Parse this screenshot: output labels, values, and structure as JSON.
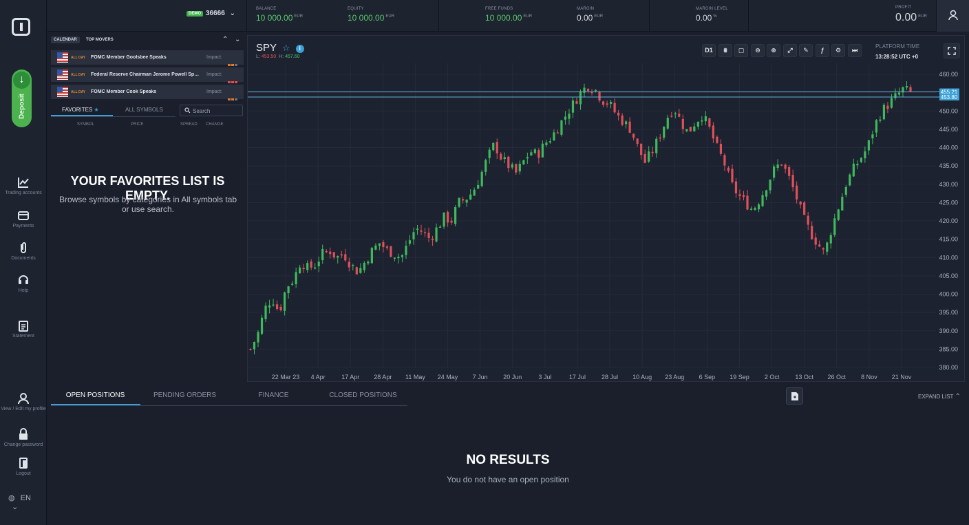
{
  "account": {
    "badge": "DEMO",
    "number": "36666"
  },
  "stats": [
    {
      "key": "BALANCE",
      "value": "10 000.00",
      "unit": "EUR"
    },
    {
      "key": "EQUITY",
      "value": "10 000.00",
      "unit": "EUR"
    },
    {
      "key": "FREE FUNDS",
      "value": "10 000.00",
      "unit": "EUR"
    },
    {
      "key": "MARGIN",
      "value": "0.00",
      "unit": "EUR"
    },
    {
      "key": "MARGIN LEVEL",
      "value": "0.00",
      "unit": "%"
    },
    {
      "key": "PROFIT",
      "value": "0.00",
      "unit": "EUR"
    }
  ],
  "nav": {
    "deposit": "Deposit",
    "trading_accounts": "Trading accounts",
    "payments": "Payments",
    "documents": "Documents",
    "help": "Help",
    "statement": "Statement",
    "profile": "View / Edit my profile",
    "change_password": "Change password",
    "logout": "Logout",
    "language": "EN"
  },
  "calendar": {
    "tabs": [
      "CALENDAR",
      "TOP MOVERS"
    ],
    "events": [
      {
        "time": "ALL DAY",
        "title": "FOMC Member Goolsbee Speaks",
        "impact_label": "Impact:",
        "impact": 2,
        "impact_color": "#e07a2e"
      },
      {
        "time": "ALL DAY",
        "title": "Federal Reserve Chairman Jerome Powell Speaks",
        "impact_label": "Impact:",
        "impact": 3,
        "impact_color": "#e24c4c"
      },
      {
        "time": "ALL DAY",
        "title": "FOMC Member Cook Speaks",
        "impact_label": "Impact:",
        "impact": 2,
        "impact_color": "#e07a2e"
      }
    ]
  },
  "favorites": {
    "tabs": [
      "FAVORITES",
      "ALL SYMBOLS"
    ],
    "search_placeholder": "Search",
    "columns": [
      "SYMBOL",
      "PRICE",
      "SPREAD",
      "CHANGE"
    ],
    "empty_title": "YOUR FAVORITES LIST IS EMPTY.",
    "empty_text": "Browse symbols by categories in All symbols tab or use search."
  },
  "chart": {
    "symbol": "SPY",
    "low_label": "L:",
    "low": "453.50",
    "high_label": "H:",
    "high": "457.60",
    "timeframe": "D1",
    "platform_time_label": "PLATFORM TIME",
    "platform_time": "13:28:52 UTC +0",
    "price_tag_ask": "455.21",
    "price_tag_bid": "453.80",
    "up_color": "#3fb95c",
    "down_color": "#e0505a"
  },
  "chart_data": {
    "type": "candlestick",
    "title": "SPY",
    "x_labels": [
      "22 Mar 23",
      "4 Apr",
      "17 Apr",
      "28 Apr",
      "11 May",
      "24 May",
      "7 Jun",
      "20 Jun",
      "3 Jul",
      "17 Jul",
      "28 Jul",
      "10 Aug",
      "23 Aug",
      "6 Sep",
      "19 Sep",
      "2 Oct",
      "13 Oct",
      "26 Oct",
      "8 Nov",
      "21 Nov"
    ],
    "y_ticks": [
      "460.00",
      "455.00",
      "450.00",
      "445.00",
      "440.00",
      "435.00",
      "430.00",
      "425.00",
      "420.00",
      "415.00",
      "410.00",
      "405.00",
      "400.00",
      "395.00",
      "390.00",
      "385.00",
      "380.00"
    ],
    "ylim": [
      380,
      460
    ],
    "close_path": [
      385,
      389,
      396,
      399,
      395,
      402,
      404,
      409,
      407,
      408,
      411,
      412,
      410,
      411,
      408,
      406,
      409,
      412,
      414,
      412,
      411,
      410,
      414,
      418,
      417,
      415,
      418,
      421,
      420,
      425,
      426,
      428,
      432,
      437,
      441,
      437,
      435,
      433,
      436,
      439,
      438,
      441,
      443,
      446,
      449,
      452,
      455,
      457,
      456,
      453,
      452,
      449,
      447,
      445,
      440,
      436,
      439,
      443,
      448,
      451,
      447,
      444,
      447,
      449,
      445,
      440,
      436,
      430,
      427,
      425,
      423,
      426,
      430,
      434,
      436,
      432,
      427,
      421,
      417,
      414,
      411,
      418,
      424,
      430,
      434,
      437,
      440,
      446,
      450,
      452,
      454,
      456,
      455
    ]
  },
  "bottom": {
    "tabs": [
      "OPEN POSITIONS",
      "PENDING ORDERS",
      "FINANCE",
      "CLOSED POSITIONS"
    ],
    "expand": "EXPAND LIST",
    "empty_title": "NO RESULTS",
    "empty_text": "You do not have an open position"
  }
}
